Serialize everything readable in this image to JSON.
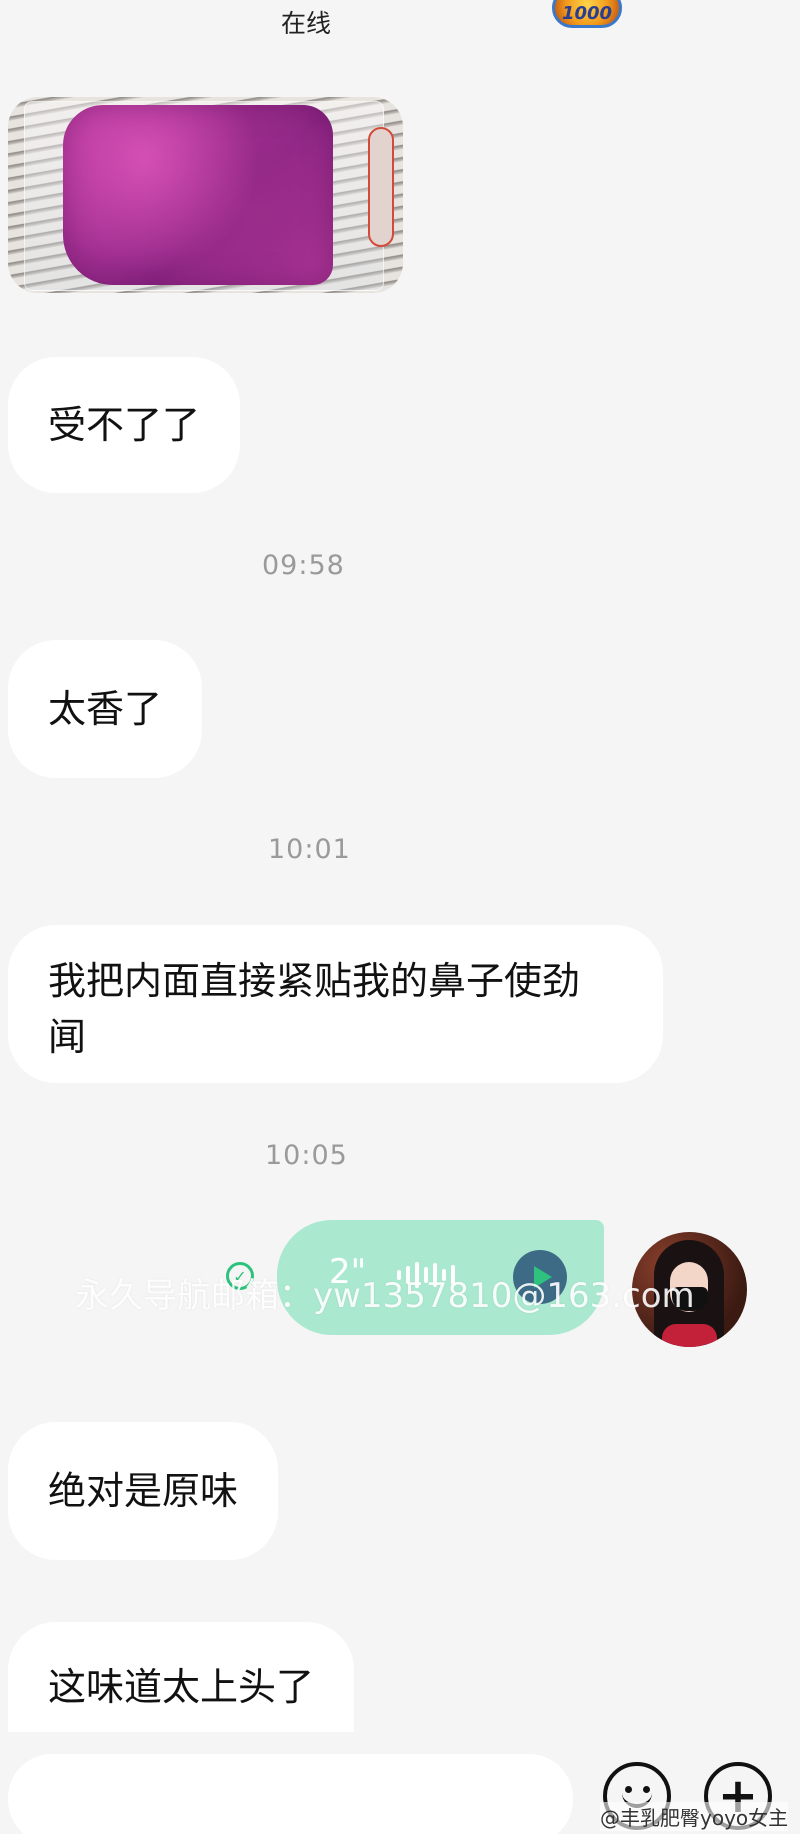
{
  "header": {
    "status": "在线",
    "badge_text": "1000"
  },
  "messages": [
    {
      "type": "image",
      "side": "left"
    },
    {
      "type": "text",
      "side": "left",
      "text": "受不了了"
    },
    {
      "type": "time",
      "text": "09:58"
    },
    {
      "type": "text",
      "side": "left",
      "text": "太香了"
    },
    {
      "type": "time",
      "text": "10:01"
    },
    {
      "type": "text",
      "side": "left",
      "text_line1": "我把内面直接紧贴我的鼻子使劲",
      "text_line2": "闻"
    },
    {
      "type": "time",
      "text": "10:05"
    },
    {
      "type": "voice",
      "side": "right",
      "duration": "2\""
    },
    {
      "type": "text",
      "side": "left",
      "text": "绝对是原味"
    },
    {
      "type": "text",
      "side": "left",
      "text": "这味道太上头了"
    }
  ],
  "watermark": "永久导航邮箱：yw1357810@163.com",
  "corner_mark": "@丰乳肥臀yoyo女主",
  "colors": {
    "background": "#f5f5f5",
    "bubble_received": "#ffffff",
    "bubble_sent_voice": "#abe8d0",
    "time_text": "#9a9a9a",
    "accent_green": "#2ec27e"
  }
}
